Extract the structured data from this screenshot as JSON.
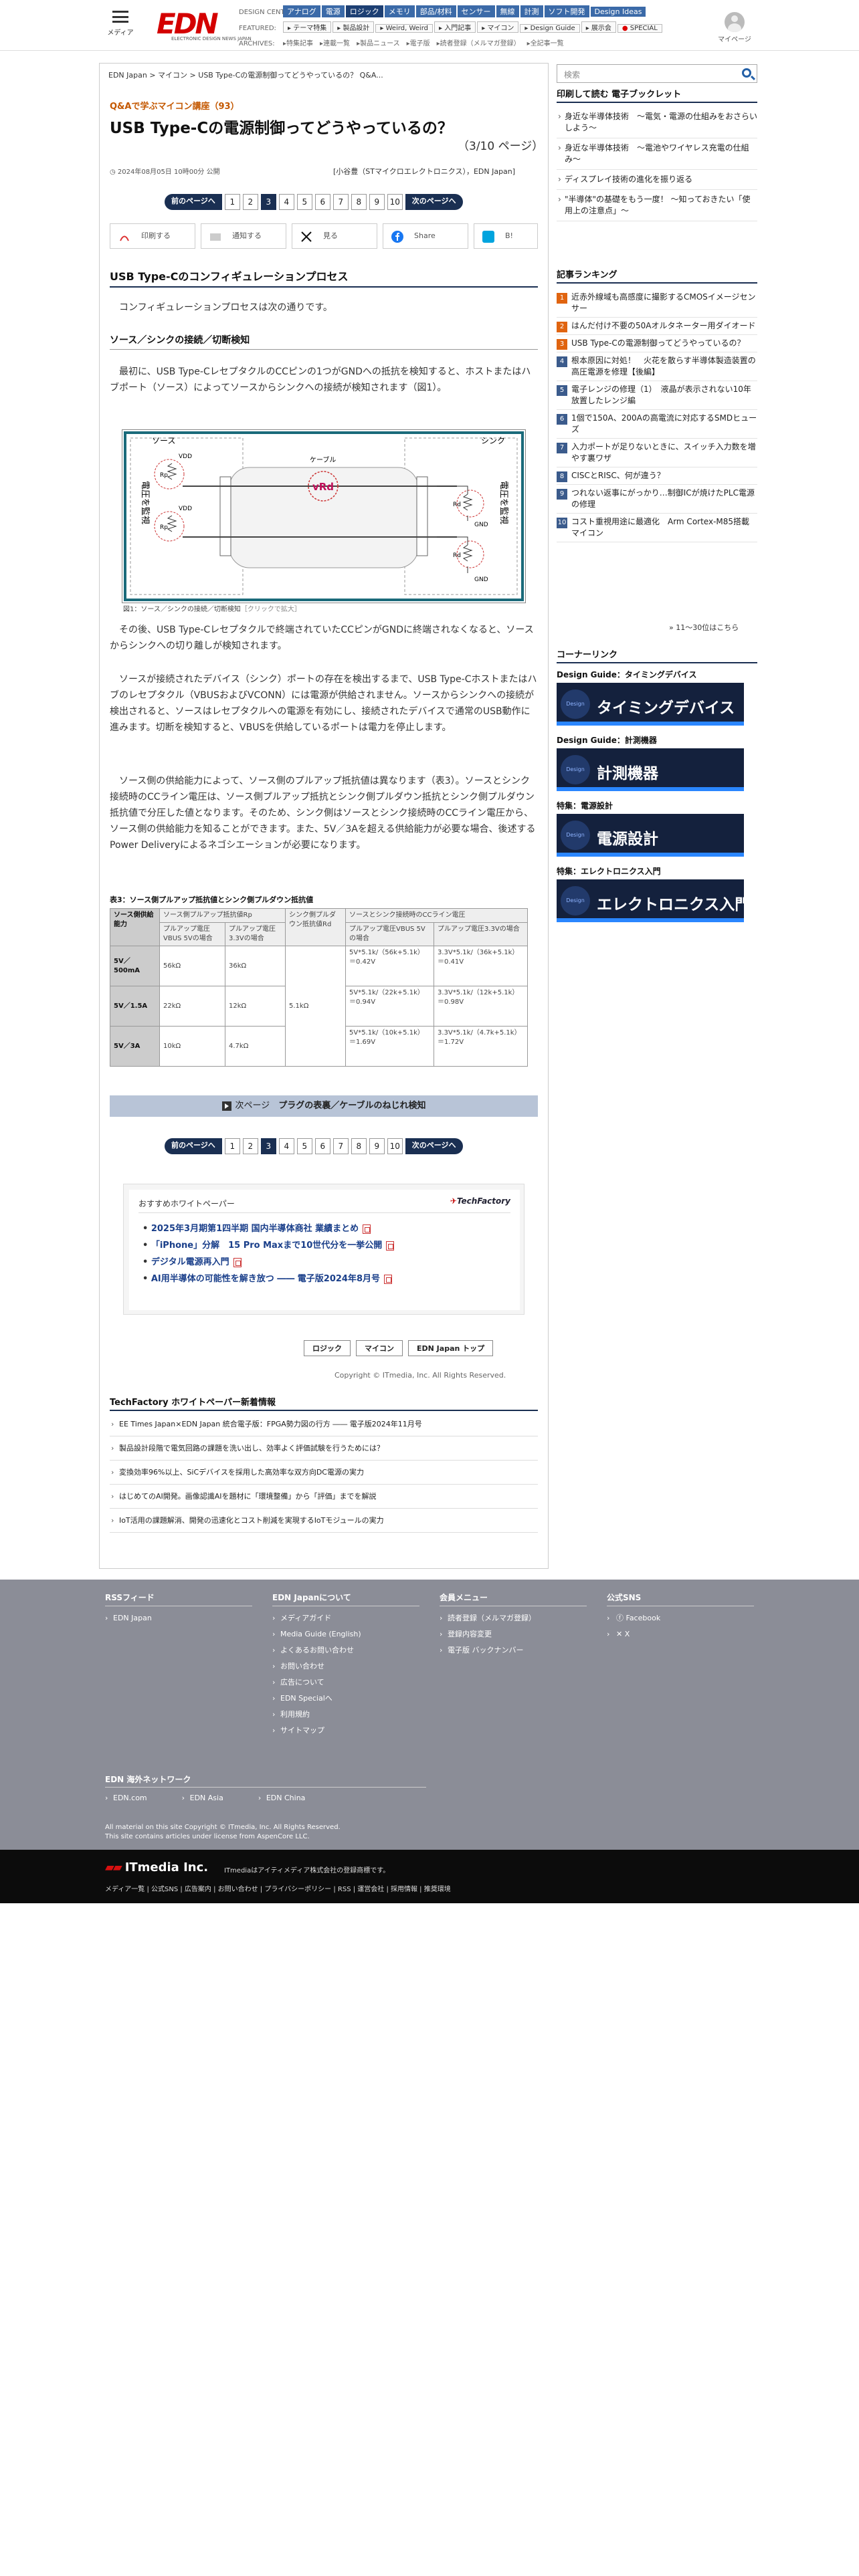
{
  "header": {
    "menu_label": "メディア",
    "logo": "EDN",
    "logo_sub": "ELECTRONIC DESIGN NEWS JAPAN",
    "design_center_label": "DESIGN CENTER:",
    "design_center": [
      "アナログ",
      "電源",
      "ロジック",
      "メモリ",
      "部品/材料",
      "センサー",
      "無線",
      "計測",
      "ソフト開発",
      "Design Ideas"
    ],
    "featured_label": "FEATURED:",
    "featured": [
      "テーマ特集",
      "製品設計",
      "Weird, Weird",
      "入門記事",
      "マイコン",
      "Design Guide",
      "展示会",
      "SPECIAL"
    ],
    "archives_label": "ARCHIVES:",
    "archives": [
      "特集記事",
      "連載一覧",
      "製品ニュース",
      "電子版",
      "読者登録（メルマガ登録）",
      "全記事一覧"
    ],
    "mypage": "マイページ"
  },
  "breadcrumb": [
    "EDN Japan",
    "マイコン",
    "USB Type-Cの電源制御ってどうやっているの？ Q&A..."
  ],
  "search": {
    "placeholder": "検索"
  },
  "article": {
    "series": "Q&Aで学ぶマイコン講座（93）",
    "title": "USB Type-Cの電源制御ってどうやっているの？",
    "page_no": "（3/10 ページ）",
    "date": "2024年08月05日 10時00分 公開",
    "author": "[小谷豊（STマイクロエレクトロニクス），EDN Japan]",
    "pager": {
      "prev": "前のページへ",
      "next": "次のページへ",
      "pages": [
        "1",
        "2",
        "3",
        "4",
        "5",
        "6",
        "7",
        "8",
        "9",
        "10"
      ],
      "current": "3"
    },
    "share": [
      "印刷する",
      "通知する",
      "見る",
      "Share",
      "B!"
    ],
    "h2": "USB Type-Cのコンフィギュレーションプロセス",
    "p1": "コンフィギュレーションプロセスは次の通りです。",
    "h3": "ソース／シンクの接続／切断検知",
    "p2": "最初に、USB Type-CレセプタクルのCCピンの1つがGNDへの抵抗を検知すると、ホストまたはハブポート（ソース）によってソースからシンクへの接続が検知されます（図1）。",
    "figure": {
      "source": "ソース",
      "sink": "シンク",
      "cable": "ケーブル",
      "monitor_l": "電圧を監視",
      "monitor_r": "電圧を監視",
      "vdd": "VDD",
      "rp": "Rp",
      "rd": "Rd",
      "vrd": "vRd",
      "gnd": "GND",
      "caption": "図1：ソース／シンクの接続／切断検知",
      "enlarge": "［クリックで拡大］"
    },
    "p3": "その後、USB Type-Cレセプタクルで終端されていたCCピンがGNDに終端されなくなると、ソースからシンクへの切り離しが検知されます。",
    "p4": "ソースが接続されたデバイス（シンク）ポートの存在を検出するまで、USB Type-Cホストまたはハブのレセプタクル（VBUSおよびVCONN）には電源が供給されません。ソースからシンクへの接続が検出されると、ソースはレセプタクルへの電源を有効にし、接続されたデバイスで通常のUSB動作に進みます。切断を検知すると、VBUSを供給しているポートは電力を停止します。",
    "p5": "ソース側の供給能力によって、ソース側のプルアップ抵抗値は異なります（表3）。ソースとシンク接続時のCCライン電圧は、ソース側プルアップ抵抗とシンク側プルダウン抵抗とシンク側プルダウン抵抗値で分圧した値となります。そのため、シンク側はソースとシンク接続時のCCライン電圧から、ソース側の供給能力を知ることができます。また、5V／3Aを超える供給能力が必要な場合、後述するPower Deliveryによるネゴシエーションが必要になります。",
    "table": {
      "caption": "表3：ソース側プルアップ抵抗値とシンク側プルダウン抵抗値",
      "h_supply": "ソース側供給能力",
      "h_rp": "ソース側プルアップ抵抗値Rp",
      "h_rp5": "プルアップ電圧VBUS 5Vの場合",
      "h_rp33": "プルアップ電圧3.3Vの場合",
      "h_rd": "シンク側プルダウン抵抗値Rd",
      "h_cc": "ソースとシンク接続時のCCライン電圧",
      "h_cc5": "プルアップ電圧VBUS 5Vの場合",
      "h_cc33": "プルアップ電圧3.3Vの場合",
      "rd_value": "5.1kΩ",
      "rows": [
        {
          "supply": "5V／500mA",
          "rp5": "56kΩ",
          "rp33": "36kΩ",
          "cc5": "5V*5.1k/（56k+5.1k）＝0.42V",
          "cc33": "3.3V*5.1k/（36k+5.1k）＝0.41V"
        },
        {
          "supply": "5V／1.5A",
          "rp5": "22kΩ",
          "rp33": "12kΩ",
          "cc5": "5V*5.1k/（22k+5.1k）＝0.94V",
          "cc33": "3.3V*5.1k/（12k+5.1k）＝0.98V"
        },
        {
          "supply": "5V／3A",
          "rp5": "10kΩ",
          "rp33": "4.7kΩ",
          "cc5": "5V*5.1k/（10k+5.1k）＝1.69V",
          "cc33": "3.3V*5.1k/（4.7k+5.1k）＝1.72V"
        }
      ]
    },
    "next_bar": {
      "label": "次ページ",
      "title": "プラグの表裏／ケーブルのねじれ検知"
    },
    "whitepaper": {
      "title": "おすすめホワイトペーパー",
      "brand": "TechFactory",
      "items": [
        "2025年3月期第1四半期 国内半導体商社 業績まとめ",
        "「iPhone」分解　15 Pro Maxまで10世代分を一挙公開",
        "デジタル電源再入門",
        "AI用半導体の可能性を解き放つ ―― 電子版2024年8月号"
      ]
    },
    "bottom_buttons": [
      "ロジック",
      "マイコン",
      "EDN Japan トップ"
    ],
    "copyright": "Copyright © ITmedia, Inc. All Rights Reserved.",
    "tf_head": "TechFactory ホワイトペーパー新着情報",
    "tf_list": [
      "EE Times Japan×EDN Japan 統合電子版：FPGA勢力図の行方 ―― 電子版2024年11月号",
      "製品設計段階で電気回路の課題を洗い出し、効率よく評価試験を行うためには？",
      "変換効率96%以上、SiCデバイスを採用した高効率な双方向DC電源の実力",
      "はじめてのAI開発。画像認識AIを題材に「環境整備」から「評価」までを解説",
      "IoT活用の課題解消、開発の迅速化とコスト削減を実現するIoTモジュールの実力"
    ]
  },
  "sidebar": {
    "booklet_head": "印刷して読む 電子ブックレット",
    "booklets": [
      "身近な半導体技術　〜電気・電源の仕組みをおさらいしよう〜",
      "身近な半導体技術　〜電池やワイヤレス充電の仕組み〜",
      "ディスプレイ技術の進化を振り返る",
      "\"半導体\"の基礎をもう一度！ 〜知っておきたい「使用上の注意点」〜"
    ],
    "ranking_head": "記事ランキング",
    "ranking": [
      "近赤外線域も高感度に撮影するCMOSイメージセンサー",
      "はんだ付け不要の50Aオルタネーター用ダイオード",
      "USB Type-Cの電源制御ってどうやっているの？",
      "根本原因に対処！　火花を散らす半導体製造装置の高圧電源を修理【後編】",
      "電子レンジの修理（1）　液晶が表示されない10年放置したレンジ編",
      "1個で150A、200Aの高電流に対応するSMDヒューズ",
      "入力ポートが足りないときに、スイッチ入力数を増やす裏ワザ",
      "CISCとRISC、何が違う？",
      "つれない返事にがっかり…制御ICが焼けたPLC電源の修理",
      "コスト重視用途に最適化　Arm Cortex-M85搭載マイコン"
    ],
    "more": "» 11〜30位はこちら",
    "corner_head": "コーナーリンク",
    "corners": [
      {
        "label": "Design Guide：タイミングデバイス",
        "banner": "タイミングデバイス"
      },
      {
        "label": "Design Guide：計測機器",
        "banner": "計測機器"
      },
      {
        "label": "特集：電源設計",
        "banner": "電源設計"
      },
      {
        "label": "特集：エレクトロニクス入門",
        "banner": "エレクトロニクス入門"
      }
    ],
    "design_guide_mark": "Design Guide"
  },
  "footer": {
    "rss_head": "RSSフィード",
    "rss": [
      "EDN Japan"
    ],
    "about_head": "EDN Japanについて",
    "about": [
      "メディアガイド",
      "Media Guide (English)",
      "よくあるお問い合わせ",
      "お問い合わせ",
      "広告について",
      "EDN Specialへ",
      "利用規約",
      "サイトマップ"
    ],
    "member_head": "会員メニュー",
    "member": [
      "読者登録（メルマガ登録）",
      "登録内容変更",
      "電子版 バックナンバー"
    ],
    "sns_head": "公式SNS",
    "sns": [
      "Facebook",
      "X"
    ],
    "network_head": "EDN 海外ネットワーク",
    "network": [
      "EDN.com",
      "EDN Asia",
      "EDN China"
    ],
    "copy1": "All material on this site Copyright © ITmedia, Inc. All Rights Reserved.",
    "copy2": "This site contains articles under license from AspenCore LLC.",
    "company": "ITmedia Inc.",
    "company_note": "ITmediaはアイティメディア株式会社の登録商標です。",
    "links": "メディア一覧 | 公式SNS | 広告案内 | お問い合わせ | プライバシーポリシー | RSS | 運営会社 | 採用情報 | 推奨環境"
  },
  "colors": {
    "navy": "#1a2f52",
    "accent_orange": "#c45800",
    "edn_red": "#d40000",
    "footer_gray": "#8b8d97"
  }
}
